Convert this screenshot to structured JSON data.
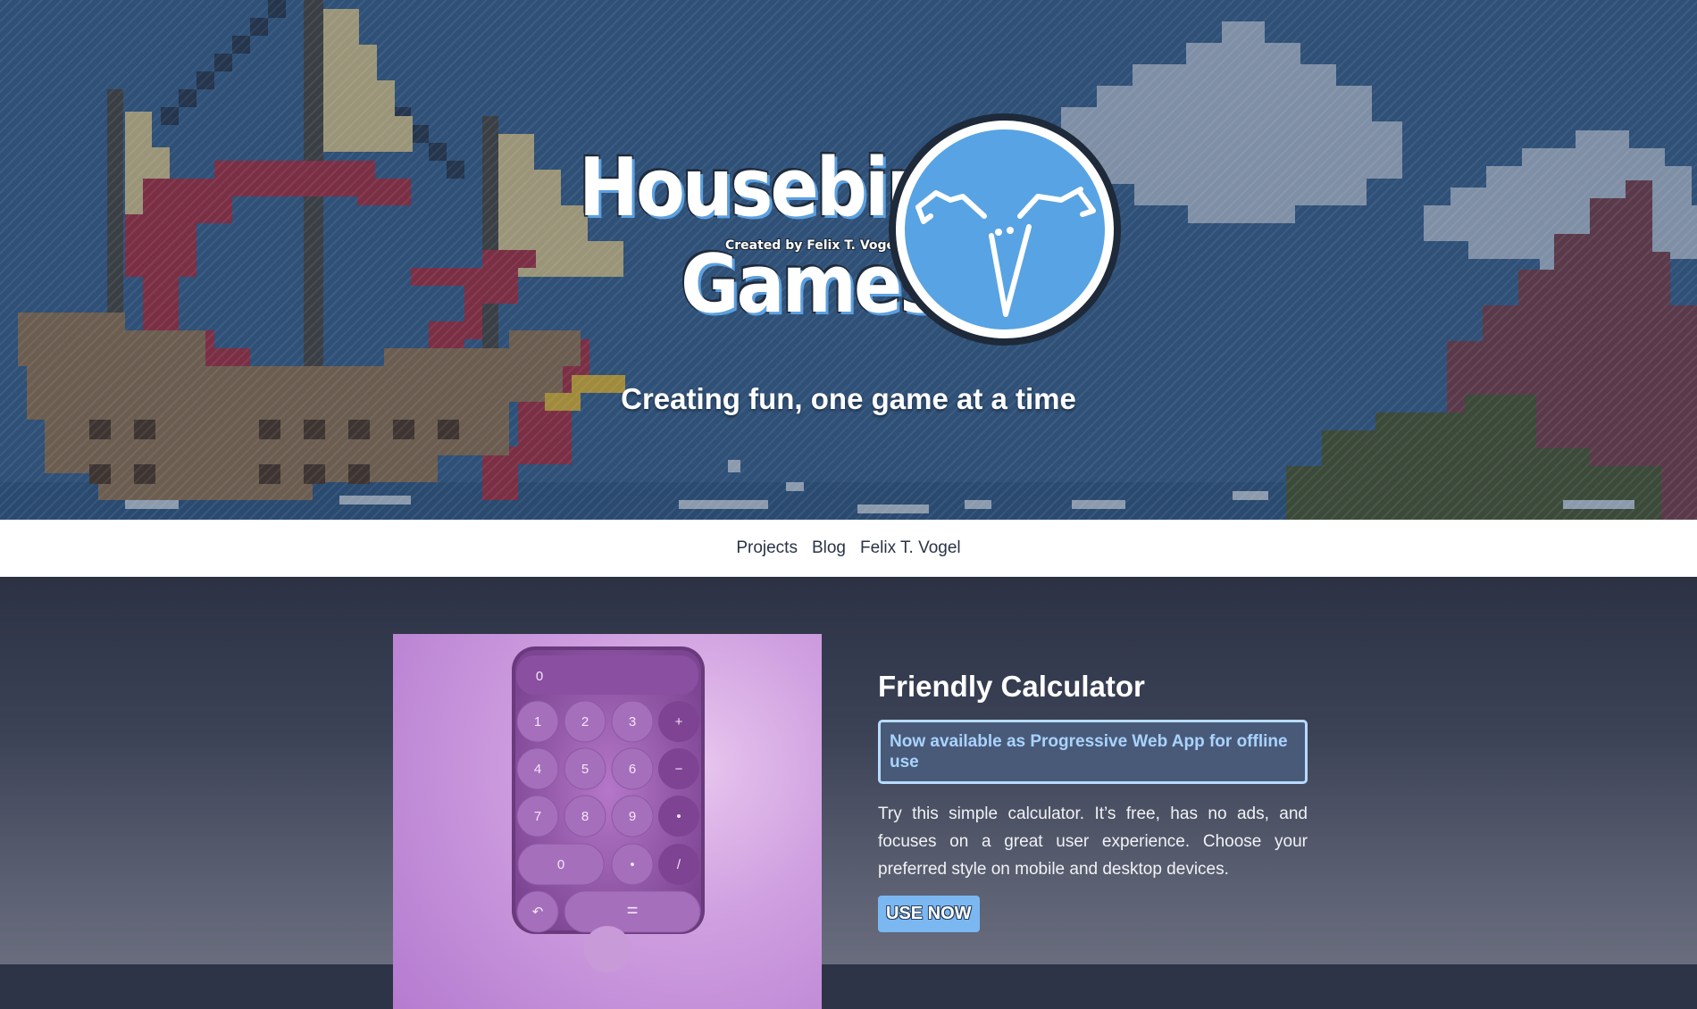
{
  "hero": {
    "logo_line1": "Housebird",
    "logo_line2": "Games",
    "logo_credit": "Created by Felix T. Vogel",
    "tagline": "Creating fun, one game at a time"
  },
  "nav": {
    "items": [
      {
        "label": "Projects"
      },
      {
        "label": "Blog"
      },
      {
        "label": "Felix T. Vogel"
      }
    ]
  },
  "project": {
    "title": "Friendly Calculator",
    "notice": "Now available as Progressive Web App for offline use",
    "description": "Try this simple calculator. It’s free, has no ads, and focuses on a great user experience. Choose your preferred style on mobile and desktop devices.",
    "cta_label": "USE NOW",
    "calculator": {
      "display": "0",
      "keys": [
        "1",
        "2",
        "3",
        "+",
        "4",
        "5",
        "6",
        "−",
        "7",
        "8",
        "9",
        "•",
        "0",
        "•",
        "/",
        "↶",
        "="
      ]
    }
  },
  "colors": {
    "hero_sky": "#2f4f78",
    "nav_bg": "#ffffff",
    "accent": "#7bb8f2",
    "logo_circle": "#58a3e3"
  }
}
